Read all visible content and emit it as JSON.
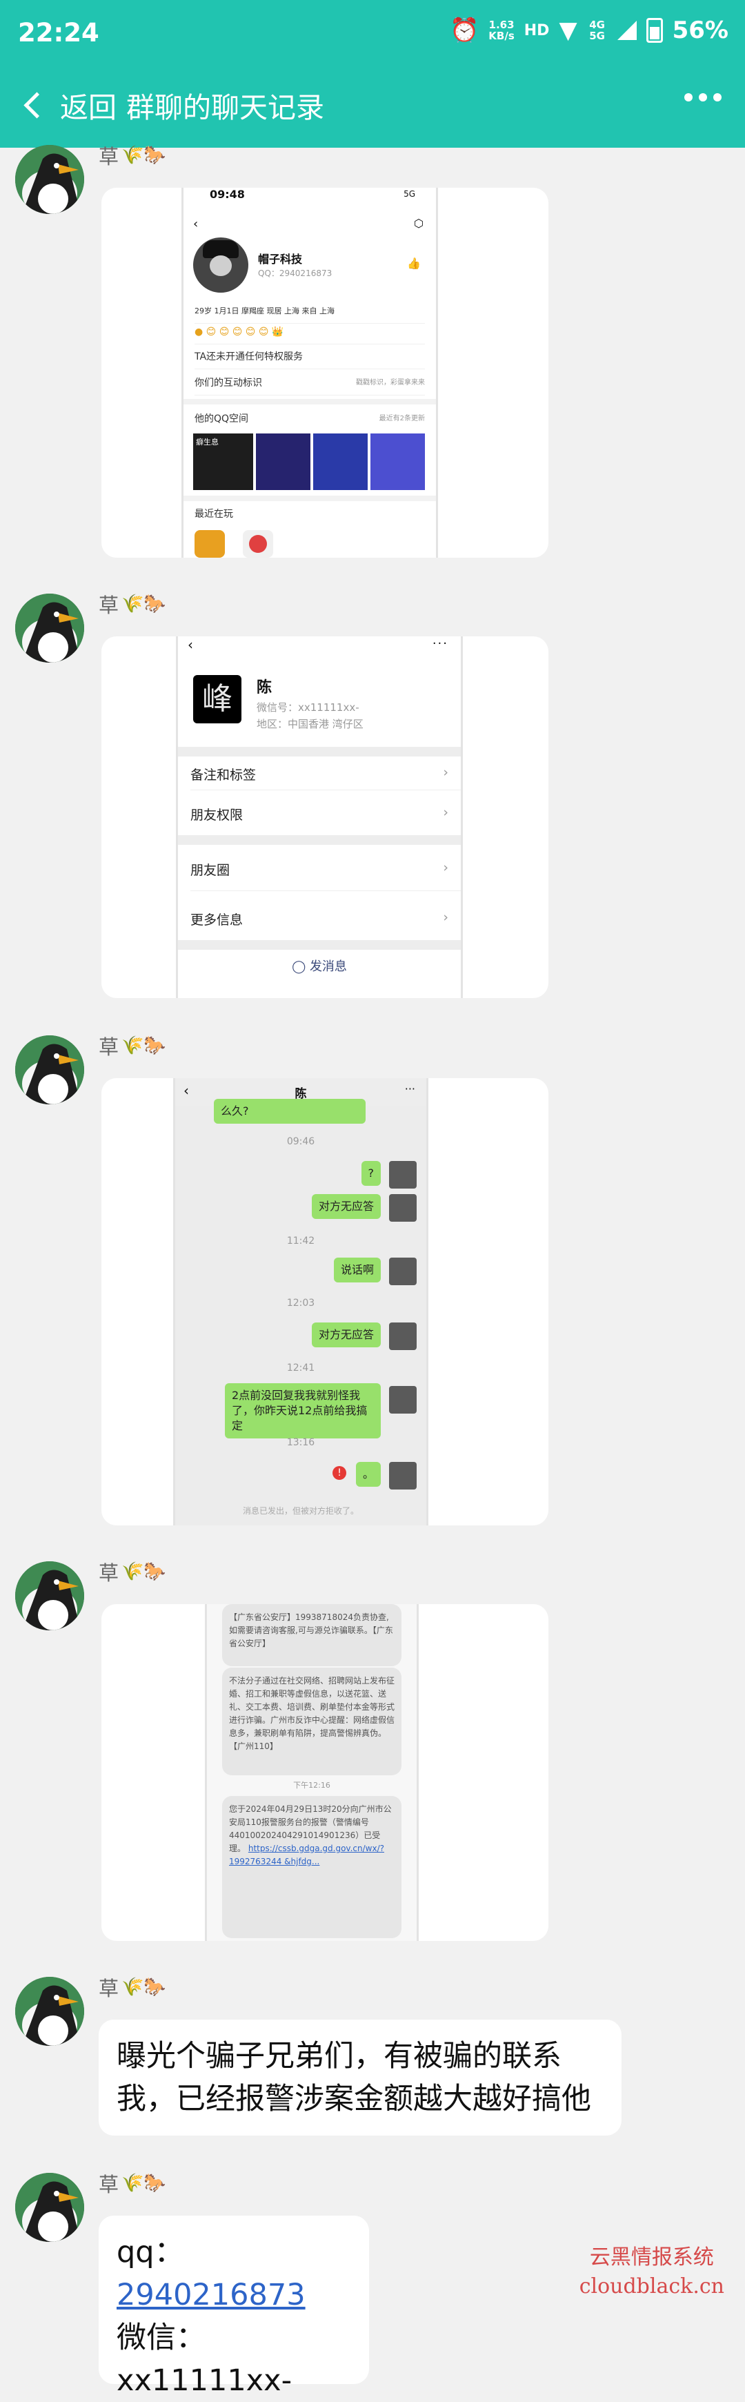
{
  "status": {
    "time": "22:24",
    "net_speed": "1.63",
    "net_unit": "KB/s",
    "network": "4G 5G",
    "battery": "56%"
  },
  "nav": {
    "back_label": "返回",
    "title": "群聊的聊天记录"
  },
  "sender_name": "草",
  "qq_profile": {
    "time": "09:48",
    "signal": "5G",
    "name": "帽子科技",
    "qq": "QQ：2940216873",
    "info": "29岁  1月1日 摩羯座  现居 上海  来自 上海",
    "special": "TA还未开通任何特权服务",
    "interaction": "你们的互动标识",
    "interaction_hint": "戳戳标识，彩蛋拿来来",
    "space": "他的QQ空间",
    "space_hint": "最近有2条更新",
    "space_thumb": "癖生息",
    "playing": "最近在玩"
  },
  "wechat_profile": {
    "name": "陈",
    "logo_text": "峰",
    "wechat_id": "微信号：xx11111xx-",
    "region": "地区：中国香港 湾仔区",
    "remark": "备注和标签",
    "permission": "朋友权限",
    "moments": "朋友圈",
    "more": "更多信息",
    "send": "发消息"
  },
  "chat": {
    "title": "陈",
    "top_bubble": "么久?",
    "messages": [
      {
        "kind": "time",
        "text": "09:46"
      },
      {
        "kind": "bubble",
        "text": "?"
      },
      {
        "kind": "bubble",
        "text": "对方无应答"
      },
      {
        "kind": "time",
        "text": "11:42"
      },
      {
        "kind": "bubble",
        "text": "说话啊"
      },
      {
        "kind": "time",
        "text": "12:03"
      },
      {
        "kind": "bubble",
        "text": "对方无应答"
      },
      {
        "kind": "time",
        "text": "12:41"
      },
      {
        "kind": "bubble",
        "text": "2点前没回复我我就别怪我了，你昨天说12点前给我搞定"
      },
      {
        "kind": "time",
        "text": "13:16"
      },
      {
        "kind": "bubble",
        "text": "。"
      }
    ],
    "footer": "消息已发出，但被对方拒收了。"
  },
  "sms": {
    "msg1": "【广东省公安厅】19938718024负责协查,如需要请咨询客服,可与源兑诈骗联系。【广东省公安厅】",
    "msg2": "不法分子通过在社交网络、招聘网站上发布征婚、招工和兼职等虚假信息，以送花篮、送礼、交工本费、培训费、刷单垫付本金等形式进行诈骗。广州市反诈中心提醒：网络虚假信息多，兼职刷单有陷阱，提高警惕辨真伪。【广州110】",
    "time": "下午12:16",
    "msg3": "您于2024年04月29日13时20分向广州市公安局110报警服务台的报警（警情编号440100202404291014901236）已受理。",
    "link": "https://cssb.gdga.gd.gov.cn/wx/?1992763244 &hjfdg..."
  },
  "text_message": {
    "line1": "曝光个骗子兄弟们，有被骗的联系",
    "line2": "我，已经报警涉案金额越大越好搞他"
  },
  "contact_message": {
    "qq_label": "qq：",
    "qq_value": "2940216873",
    "wechat_line": "微信：xx11111xx-"
  },
  "watermark": {
    "line1": "云黑情报系统",
    "line2": "cloudblack.cn"
  }
}
